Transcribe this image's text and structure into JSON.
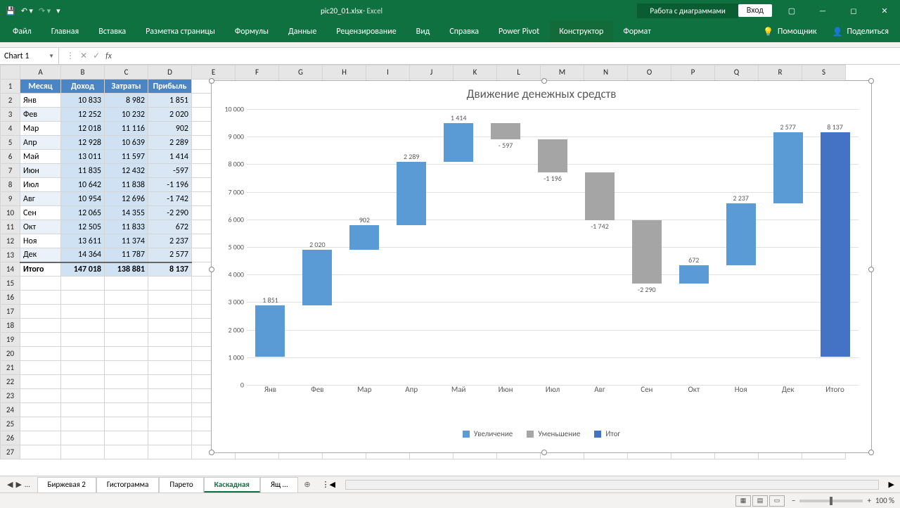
{
  "title": {
    "filename": "pic20_01.xlsx",
    "app": " - Excel",
    "chart_tools": "Работа с диаграммами",
    "signin": "Вход"
  },
  "ribbon_tabs": [
    "Файл",
    "Главная",
    "Вставка",
    "Разметка страницы",
    "Формулы",
    "Данные",
    "Рецензирование",
    "Вид",
    "Справка",
    "Power Pivot",
    "Конструктор",
    "Формат"
  ],
  "tellme": "Помощник",
  "share": "Поделиться",
  "namebox": "Chart 1",
  "columns": [
    "A",
    "B",
    "C",
    "D",
    "E",
    "F",
    "G",
    "H",
    "I",
    "J",
    "K",
    "L",
    "M",
    "N",
    "O",
    "P",
    "Q",
    "R",
    "S"
  ],
  "table_header": [
    "Месяц",
    "Доход",
    "Затраты",
    "Прибыль"
  ],
  "rows": [
    [
      "Янв",
      "10 833",
      "8 982",
      "1 851"
    ],
    [
      "Фев",
      "12 252",
      "10 232",
      "2 020"
    ],
    [
      "Мар",
      "12 018",
      "11 116",
      "902"
    ],
    [
      "Апр",
      "12 928",
      "10 639",
      "2 289"
    ],
    [
      "Май",
      "13 011",
      "11 597",
      "1 414"
    ],
    [
      "Июн",
      "11 835",
      "12 432",
      "-597"
    ],
    [
      "Июл",
      "10 642",
      "11 838",
      "-1 196"
    ],
    [
      "Авг",
      "10 954",
      "12 696",
      "-1 742"
    ],
    [
      "Сен",
      "12 065",
      "14 355",
      "-2 290"
    ],
    [
      "Окт",
      "12 505",
      "11 833",
      "672"
    ],
    [
      "Ноя",
      "13 611",
      "11 374",
      "2 237"
    ],
    [
      "Дек",
      "14 364",
      "11 787",
      "2 577"
    ],
    [
      "Итого",
      "147 018",
      "138 881",
      "8 137"
    ]
  ],
  "chart_data": {
    "type": "waterfall",
    "title": "Движение денежных средств",
    "categories": [
      "Янв",
      "Фев",
      "Мар",
      "Апр",
      "Май",
      "Июн",
      "Июл",
      "Авг",
      "Сен",
      "Окт",
      "Ноя",
      "Дек",
      "Итого"
    ],
    "values": [
      1851,
      2020,
      902,
      2289,
      1414,
      -597,
      -1196,
      -1742,
      -2290,
      672,
      2237,
      2577,
      8137
    ],
    "labels": [
      "1 851",
      "2 020",
      "902",
      "2 289",
      "1 414",
      "- 597",
      "-1 196",
      "-1 742",
      "-2 290",
      "672",
      "2 237",
      "2 577",
      "8 137"
    ],
    "cumulative_start": [
      0,
      1851,
      3871,
      4773,
      7062,
      8476,
      7879,
      6683,
      4941,
      2651,
      3323,
      5560,
      0
    ],
    "cumulative_end": [
      1851,
      3871,
      4773,
      7062,
      8476,
      7879,
      6683,
      4941,
      2651,
      3323,
      5560,
      8137,
      8137
    ],
    "is_total": [
      false,
      false,
      false,
      false,
      false,
      false,
      false,
      false,
      false,
      false,
      false,
      false,
      true
    ],
    "y_ticks": [
      0,
      1000,
      2000,
      3000,
      4000,
      5000,
      6000,
      7000,
      8000,
      9000,
      10000
    ],
    "y_tick_labels": [
      "0",
      "1 000",
      "2 000",
      "3 000",
      "4 000",
      "5 000",
      "6 000",
      "7 000",
      "8 000",
      "9 000",
      "10 000"
    ],
    "ylim": [
      0,
      10000
    ],
    "legend": [
      "Увеличение",
      "Уменьшение",
      "Итог"
    ],
    "colors": {
      "increase": "#5b9bd5",
      "decrease": "#a5a5a5",
      "total": "#4472c4"
    }
  },
  "sheet_tabs": {
    "dots": "…",
    "items": [
      "Биржевая 2",
      "Гистограмма",
      "Парето",
      "Каскадная",
      "Ящ …"
    ],
    "active": 3
  },
  "status": {
    "zoom": "100 %"
  }
}
